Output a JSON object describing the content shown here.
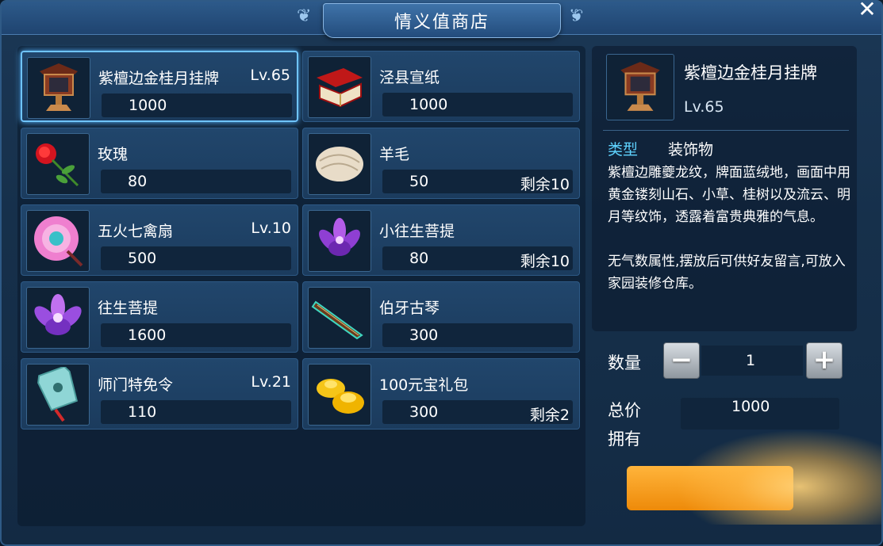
{
  "window": {
    "title": "情义值商店"
  },
  "items": [
    {
      "name": "紫檀边金桂月挂牌",
      "level": "Lv.65",
      "price": "1000",
      "remaining": "",
      "icon": "wooden-plaque-icon",
      "selected": true
    },
    {
      "name": "泾县宣纸",
      "level": "",
      "price": "1000",
      "remaining": "",
      "icon": "paper-box-icon"
    },
    {
      "name": "玫瑰",
      "level": "",
      "price": "80",
      "remaining": "",
      "icon": "rose-icon"
    },
    {
      "name": "羊毛",
      "level": "",
      "price": "50",
      "remaining": "剩余10",
      "icon": "wool-icon"
    },
    {
      "name": "五火七禽扇",
      "level": "Lv.10",
      "price": "500",
      "remaining": "",
      "icon": "feather-fan-icon"
    },
    {
      "name": "小往生菩提",
      "level": "",
      "price": "80",
      "remaining": "剩余10",
      "icon": "purple-flower-icon"
    },
    {
      "name": "往生菩提",
      "level": "",
      "price": "1600",
      "remaining": "",
      "icon": "purple-lotus-icon"
    },
    {
      "name": "伯牙古琴",
      "level": "",
      "price": "300",
      "remaining": "",
      "icon": "guqin-icon"
    },
    {
      "name": "师门特免令",
      "level": "Lv.21",
      "price": "110",
      "remaining": "",
      "icon": "jade-token-icon"
    },
    {
      "name": "100元宝礼包",
      "level": "",
      "price": "300",
      "remaining": "剩余2",
      "icon": "gold-ingot-icon"
    }
  ],
  "detail": {
    "name": "紫檀边金桂月挂牌",
    "level": "Lv.65",
    "type_label": "类型",
    "type_value": "装饰物",
    "description_1": "紫檀边雕夔龙纹，牌面蓝绒地，画面中用黄金镂刻山石、小草、桂树以及流云、明月等纹饰，透露着富贵典雅的气息。",
    "description_2": "无气数属性,摆放后可供好友留言,可放入家园装修仓库。"
  },
  "purchase": {
    "quantity_label": "数量",
    "quantity": "1",
    "total_label": "总价",
    "total": "1000",
    "owned_label": "拥有"
  },
  "colors": {
    "accent": "#6fc4ff",
    "type_label": "#5fd3ff",
    "buy_button": "#f29a16"
  }
}
